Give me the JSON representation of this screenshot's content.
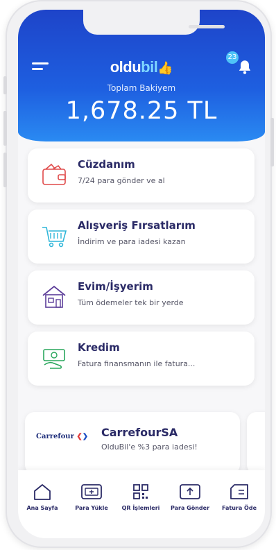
{
  "app": {
    "logo_main": "oldu",
    "logo_accent": "bil"
  },
  "header": {
    "notification_count": "23",
    "balance_label": "Toplam Bakiyem",
    "balance_value": "1,678.25 TL"
  },
  "cards": [
    {
      "title": "Cüzdanım",
      "subtitle": "7/24 para gönder ve al",
      "icon": "wallet-icon",
      "color": "#e04a4a"
    },
    {
      "title": "Alışveriş Fırsatlarım",
      "subtitle": "İndirim ve para iadesi kazan",
      "icon": "shopping-cart-icon",
      "color": "#2fb6d9"
    },
    {
      "title": "Evim/İşyerim",
      "subtitle": "Tüm ödemeler tek bir yerde",
      "icon": "house-icon",
      "color": "#5c3d99"
    },
    {
      "title": "Kredim",
      "subtitle": "Fatura finansmanın ile fatura...",
      "icon": "money-hand-icon",
      "color": "#2aa75d"
    }
  ],
  "promo": {
    "brand_logo": "Carrefour",
    "title": "CarrefourSA",
    "subtitle": "OlduBil'e %3 para iadesi!"
  },
  "tabs": [
    {
      "label": "Ana Sayfa",
      "icon": "home-icon"
    },
    {
      "label": "Para Yükle",
      "icon": "load-money-icon"
    },
    {
      "label": "QR İşlemleri",
      "icon": "qr-code-icon"
    },
    {
      "label": "Para Gönder",
      "icon": "send-money-icon"
    },
    {
      "label": "Fatura Öde",
      "icon": "bill-pay-icon"
    }
  ],
  "colors": {
    "header_top": "#1e44c9",
    "header_bottom": "#2a8af2",
    "title_text": "#2a2a66"
  }
}
